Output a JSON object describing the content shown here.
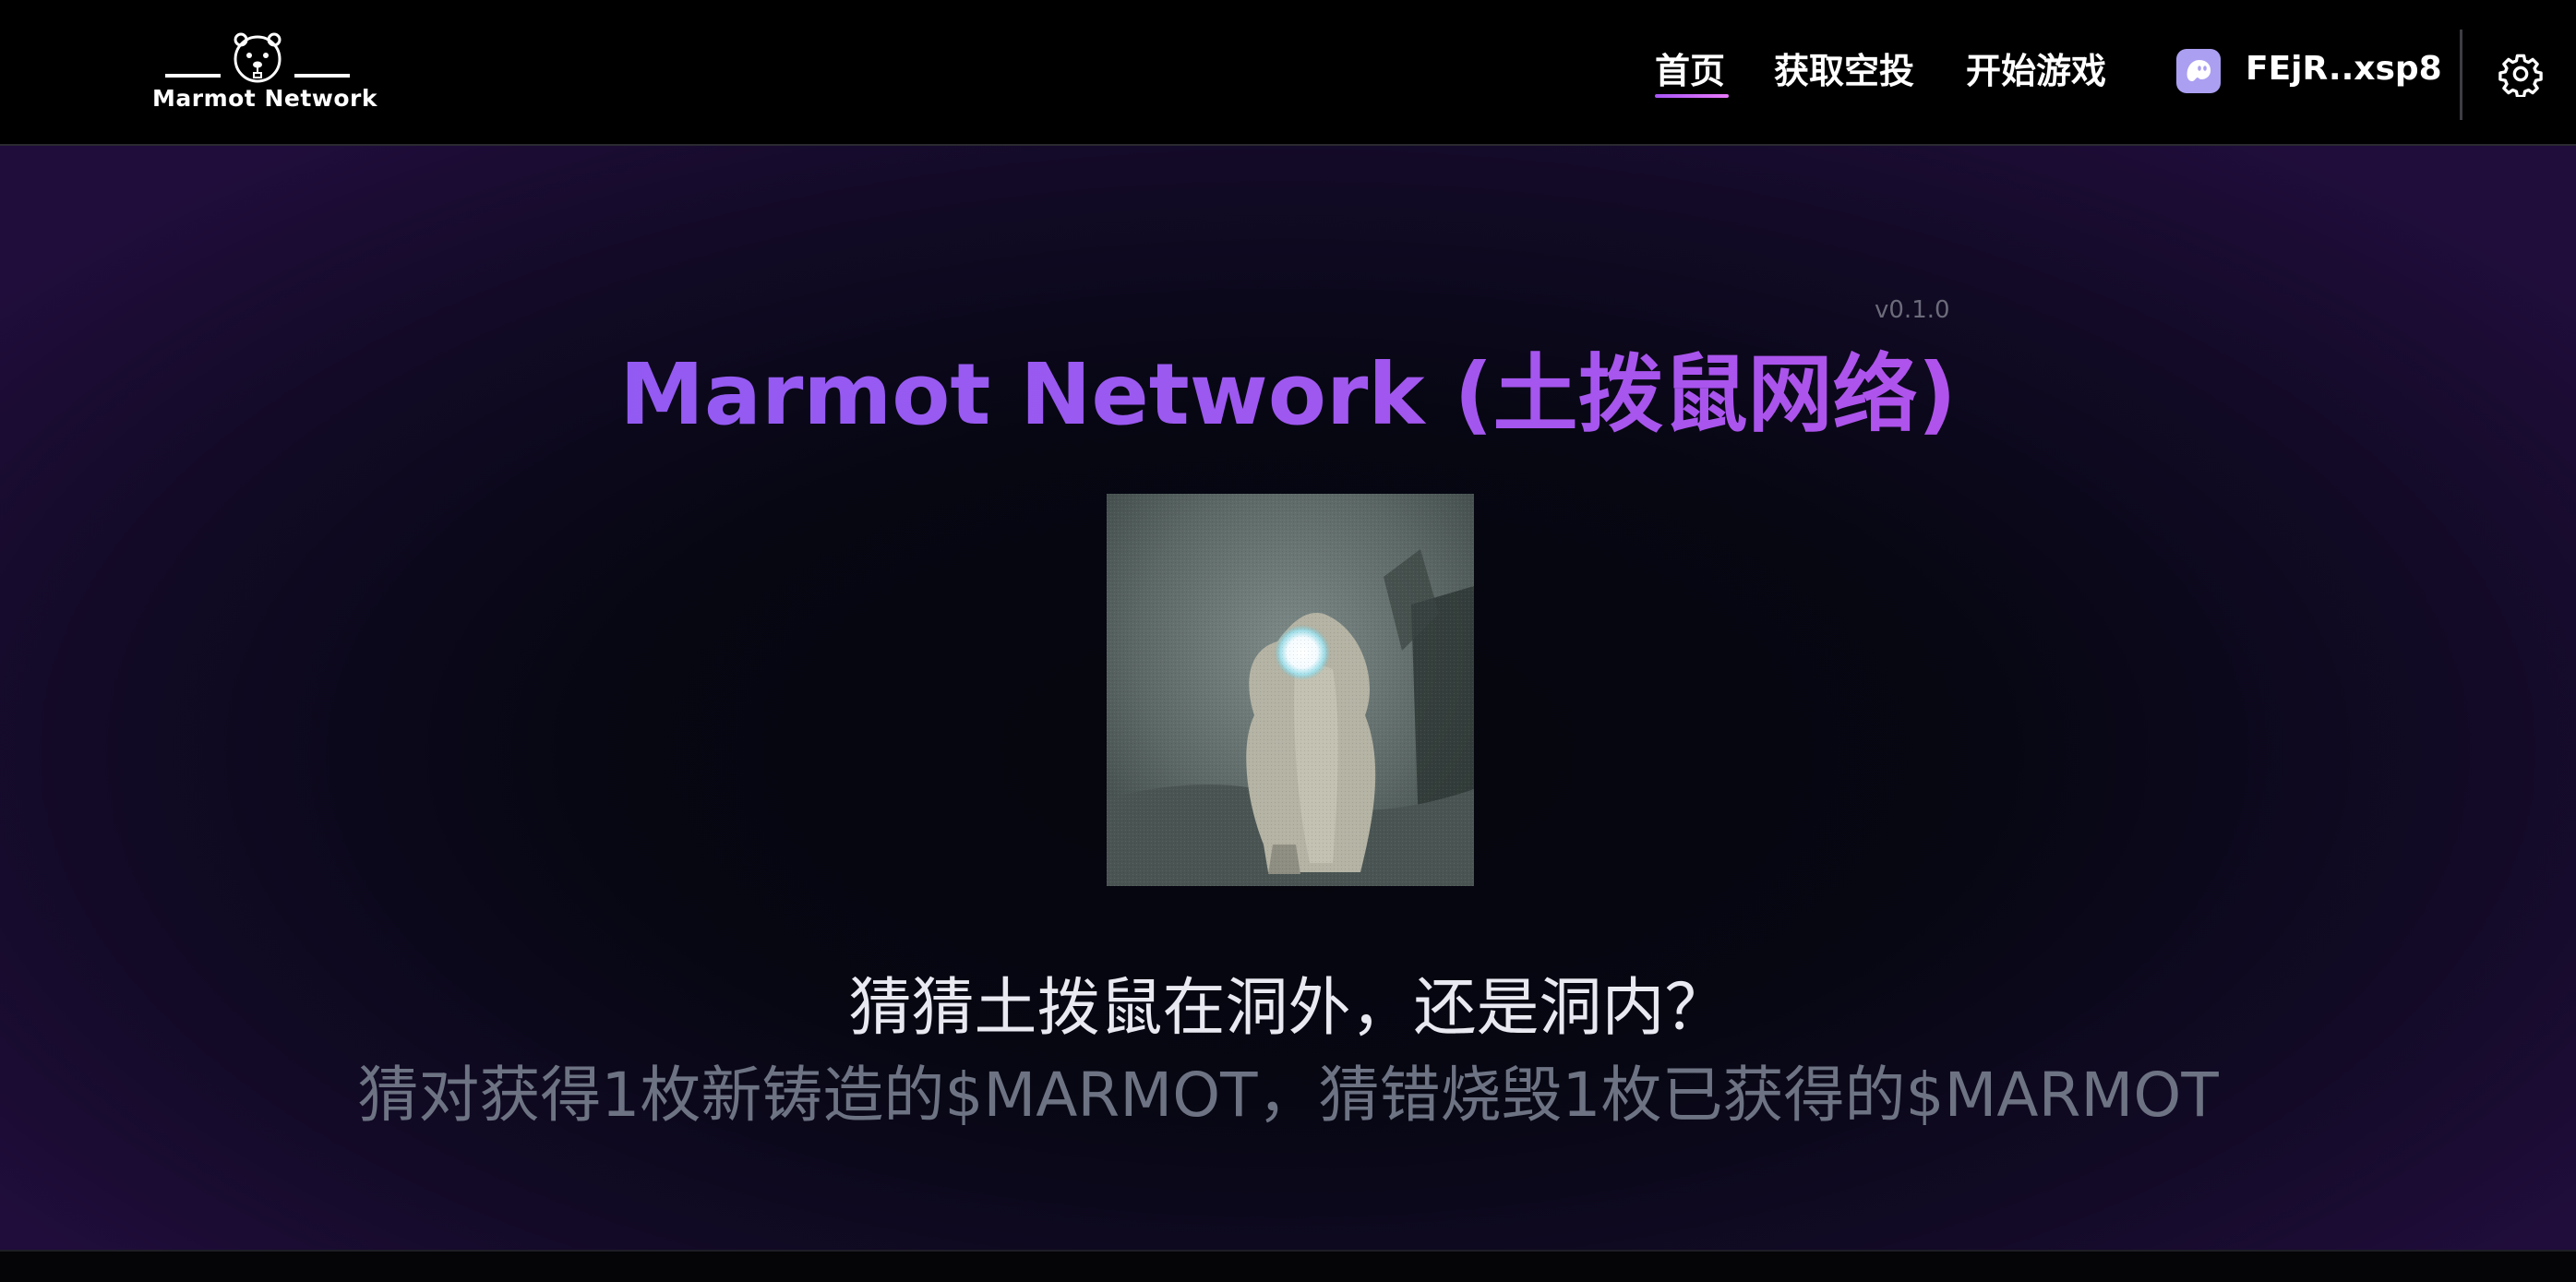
{
  "brand": {
    "logo_text": "Marmot Network"
  },
  "nav": {
    "items": [
      {
        "label": "首页",
        "active": true
      },
      {
        "label": "获取空投",
        "active": false
      },
      {
        "label": "开始游戏",
        "active": false
      }
    ],
    "active_underline_color": "#a855f7"
  },
  "wallet": {
    "address": "FEjR..xsp8",
    "icon": "phantom-ghost-icon",
    "icon_color": "#ab9ff2"
  },
  "settings": {
    "icon": "gear-icon"
  },
  "hero": {
    "version": "v0.1.0",
    "title": "Marmot Network (土拨鼠网络)",
    "title_gradient": [
      "#8a5cf6",
      "#c04ee8"
    ],
    "image": "marmot-photo",
    "question": "猜猜土拨鼠在洞外，还是洞内？",
    "rule": "猜对获得1枚新铸造的$MARMOT，猜错烧毁1枚已获得的$MARMOT"
  },
  "colors": {
    "background": "#000000",
    "hero_bg_edge": "#200d3b",
    "question_text": "#e9e9f2",
    "rule_text": "#6d7383"
  }
}
